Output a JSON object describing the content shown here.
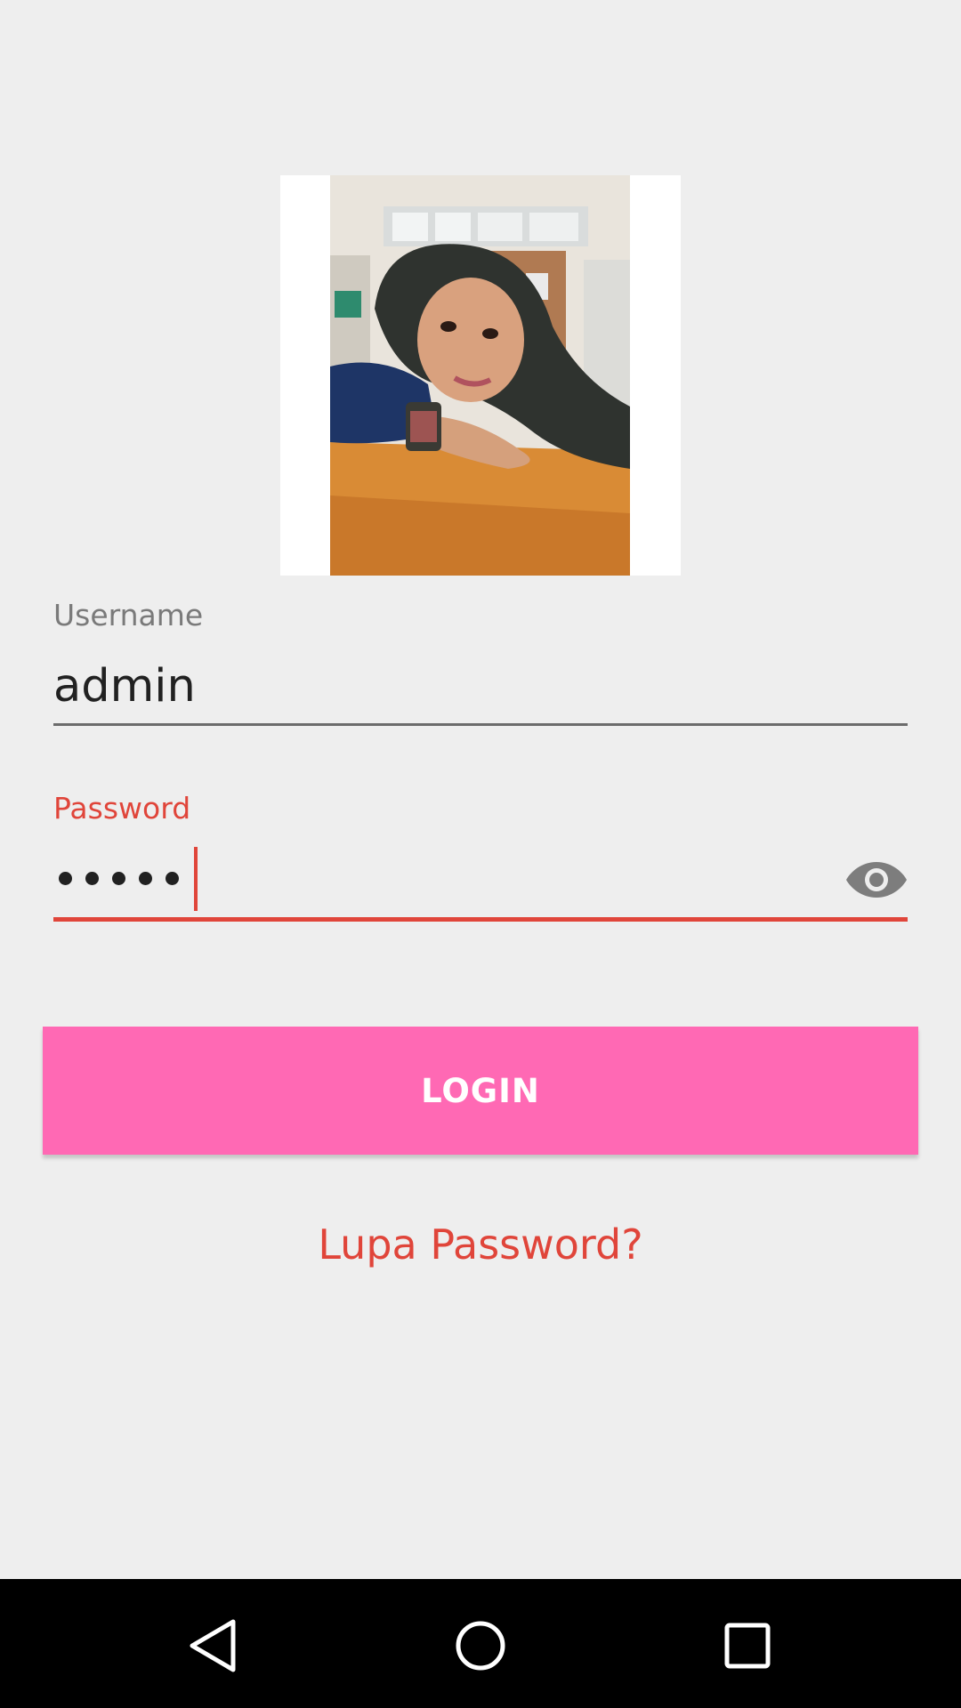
{
  "profile": {
    "photo_icon": "profile-photo"
  },
  "username": {
    "label": "Username",
    "value": "admin"
  },
  "password": {
    "label": "Password",
    "masked_length": 5,
    "toggle_icon": "eye-icon"
  },
  "login_button": {
    "label": "LOGIN"
  },
  "forgot_link": {
    "label": "Lupa Password?"
  },
  "nav": {
    "back_icon": "back-triangle-icon",
    "home_icon": "home-circle-icon",
    "recent_icon": "recent-square-icon"
  },
  "colors": {
    "accent": "#e0453a",
    "button": "#ff69b4",
    "background": "#eeeeee"
  }
}
